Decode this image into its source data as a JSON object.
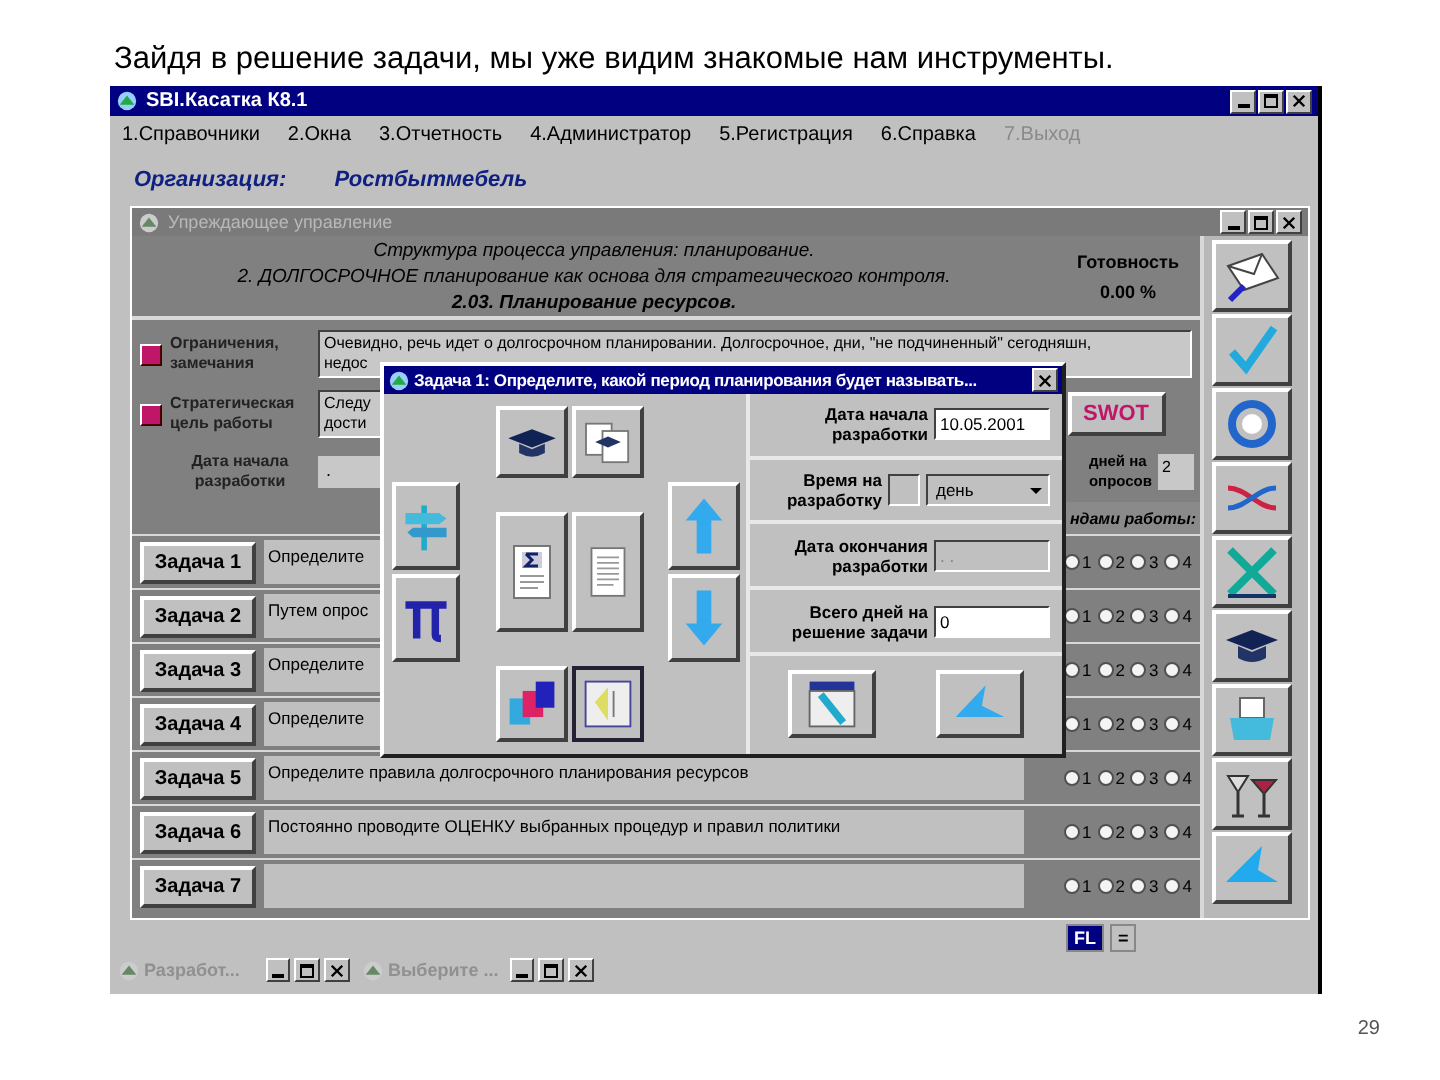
{
  "slide_title": "Зайдя в решение задачи, мы уже видим знакомые нам инструменты.",
  "main_window": {
    "title": "SBI.Касатка К8.1"
  },
  "menu": [
    {
      "label": "1.Справочники",
      "disabled": false
    },
    {
      "label": "2.Окна",
      "disabled": false
    },
    {
      "label": "3.Отчетность",
      "disabled": false
    },
    {
      "label": "4.Администратор",
      "disabled": false
    },
    {
      "label": "5.Регистрация",
      "disabled": false
    },
    {
      "label": "6.Справка",
      "disabled": false
    },
    {
      "label": "7.Выход",
      "disabled": true
    }
  ],
  "organization": {
    "label": "Организация:",
    "value": "Ростбытмебель"
  },
  "inner_window": {
    "title": "Упреждающее управление"
  },
  "header": {
    "lines": [
      "Структура процесса управления: планирование.",
      "2. ДОЛГОСРОЧНОЕ планирование как основа для стратегического контроля.",
      "2.03. Планирование ресурсов."
    ],
    "readiness_label": "Готовность",
    "readiness_value": "0.00 %"
  },
  "notes": [
    {
      "label": [
        "Ограничения,",
        "замечания"
      ],
      "lines": [
        "Очевидно, речь идет о долгосрочном планировании. Долгосрочное, дни, \"не подчиненный\" сегодняшн,",
        "недос"
      ]
    },
    {
      "label": [
        "Стратегическая",
        "цель работы"
      ],
      "lines": [
        "Следу",
        "дости"
      ]
    }
  ],
  "start_date": {
    "label": [
      "Дата начала",
      "разработки"
    ],
    "value": "."
  },
  "swot_button": "SWOT",
  "survey_days": {
    "label": [
      "дней на",
      "опросов"
    ],
    "value": "2"
  },
  "criteria_header": "ндами работы:",
  "tasks": [
    {
      "button": "Задача 1",
      "text": "Определите",
      "options": [
        {
          "label": "1",
          "selected": false
        },
        {
          "label": "2",
          "selected": false
        },
        {
          "label": "3",
          "selected": false
        },
        {
          "label": "4",
          "selected": false
        }
      ]
    },
    {
      "button": "Задача 2",
      "text": "Путем опрос",
      "options": [
        {
          "label": "1",
          "selected": false
        },
        {
          "label": "2",
          "selected": false
        },
        {
          "label": "3",
          "selected": false
        },
        {
          "label": "4",
          "selected": false
        }
      ]
    },
    {
      "button": "Задача 3",
      "text": "Определите",
      "options": [
        {
          "label": "1",
          "selected": false
        },
        {
          "label": "2",
          "selected": false
        },
        {
          "label": "3",
          "selected": false
        },
        {
          "label": "4",
          "selected": false
        }
      ]
    },
    {
      "button": "Задача 4",
      "text": "Определите",
      "options": [
        {
          "label": "1",
          "selected": false
        },
        {
          "label": "2",
          "selected": false
        },
        {
          "label": "3",
          "selected": false
        },
        {
          "label": "4",
          "selected": false
        }
      ]
    },
    {
      "button": "Задача 5",
      "text": "Определите правила долгосрочного планирования ресурсов",
      "options": [
        {
          "label": "1",
          "selected": false
        },
        {
          "label": "2",
          "selected": false
        },
        {
          "label": "3",
          "selected": false
        },
        {
          "label": "4",
          "selected": false
        }
      ]
    },
    {
      "button": "Задача 6",
      "text": "Постоянно проводите ОЦЕНКУ выбранных процедур и правил политики",
      "options": [
        {
          "label": "1",
          "selected": false
        },
        {
          "label": "2",
          "selected": false
        },
        {
          "label": "3",
          "selected": false
        },
        {
          "label": "4",
          "selected": false
        }
      ]
    },
    {
      "button": "Задача 7",
      "options": [
        {
          "label": "1",
          "selected": false
        },
        {
          "label": "2",
          "selected": false
        },
        {
          "label": "3",
          "selected": false
        },
        {
          "label": "4",
          "selected": false
        }
      ]
    }
  ],
  "status_items": [
    "FL",
    "="
  ],
  "taskbar": [
    {
      "label": "Разработ..."
    },
    {
      "label": "Выберите ..."
    }
  ],
  "dialog": {
    "title": "Задача 1: Определите, какой период планирования будет называть...",
    "fields": [
      {
        "kind": "text",
        "label": [
          "Дата начала",
          "разработки"
        ],
        "value": "10.05.2001",
        "disabled": false
      },
      {
        "kind": "duration",
        "label": [
          "Время на",
          "разработку"
        ],
        "unit": "день"
      },
      {
        "kind": "text",
        "label": [
          "Дата окончания",
          "разработки"
        ],
        "value": ". .",
        "disabled": true
      },
      {
        "kind": "text",
        "label": [
          "Всего дней на",
          "решение задачи"
        ],
        "value": "0",
        "disabled": false
      }
    ]
  },
  "page_number": "29"
}
